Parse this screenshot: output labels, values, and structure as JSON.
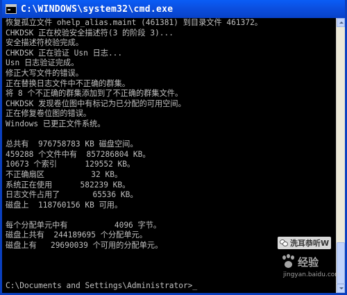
{
  "window": {
    "title": "C:\\WINDOWS\\system32\\cmd.exe"
  },
  "console": {
    "lines": [
      "恢复孤立文件 ohelp_alias.maint (461381) 到目录文件 461372。",
      "CHKDSK 正在校验安全描述符(3 的阶段 3)...",
      "安全描述符校验完成。",
      "CHKDSK 正在验证 Usn 日志...",
      "Usn 日志验证完成。",
      "修正大写文件的错误。",
      "正在替换日志文件中不正确的群集。",
      "将 8 个不正确的群集添加到了不正确的群集文件。",
      "CHKDSK 发现卷位图中有标记为已分配的可用空间。",
      "正在修复卷位图的错误。",
      "Windows 已更正文件系统。",
      "",
      "总共有  976758783 KB 磁盘空间。",
      "459288 个文件中有  857286804 KB。",
      "10673 个索引      129552 KB。",
      "不正确扇区          32 KB。",
      "系统正在使用      582239 KB。",
      "日志文件占用了       65536 KB。",
      "磁盘上  118760156 KB 可用。",
      "",
      "每个分配单元中有          4096 字节。",
      "磁盘上共有  244189695 个分配单元。",
      "磁盘上有   29690039 个可用的分配单元。",
      "",
      "",
      "",
      "C:\\Documents and Settings\\Administrator>_"
    ]
  },
  "watermarks": {
    "baidu_text": "经验",
    "baidu_sub": "jingyan.baidu.com",
    "wechat_text": "洗耳恭听W"
  }
}
